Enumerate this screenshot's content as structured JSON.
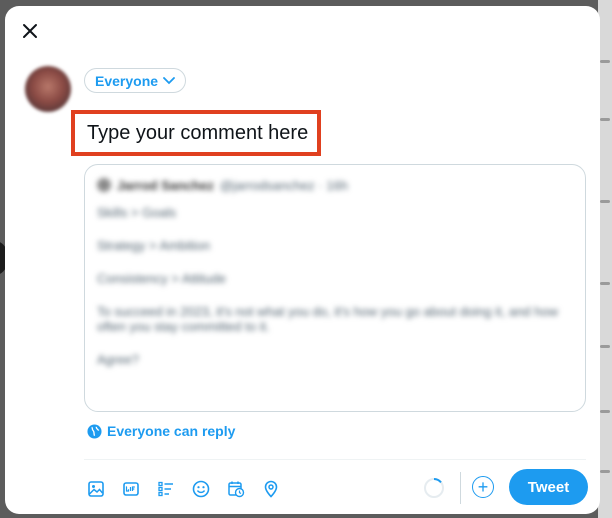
{
  "composer": {
    "audience_label": "Everyone",
    "comment_placeholder": "Type your comment here",
    "reply_setting_label": "Everyone can reply",
    "tweet_button_label": "Tweet",
    "add_button_label": "+"
  },
  "quoted_tweet": {
    "author_name": "Jarrod Sanchez",
    "author_handle": "@jarrodsanchez · 16h",
    "lines": [
      "Skills > Goals",
      "Strategy > Ambition",
      "Consistency > Attitude",
      "To succeed in 2023, it's not what you do, it's how you go about doing it, and how often you stay committed to it.",
      "Agree?"
    ]
  },
  "toolbar": {
    "icons": [
      "image-icon",
      "gif-icon",
      "poll-icon",
      "emoji-icon",
      "schedule-icon",
      "location-icon"
    ]
  },
  "colors": {
    "accent": "#1d9bf0",
    "highlight_border": "#e0401f",
    "border": "#cfd9de"
  }
}
